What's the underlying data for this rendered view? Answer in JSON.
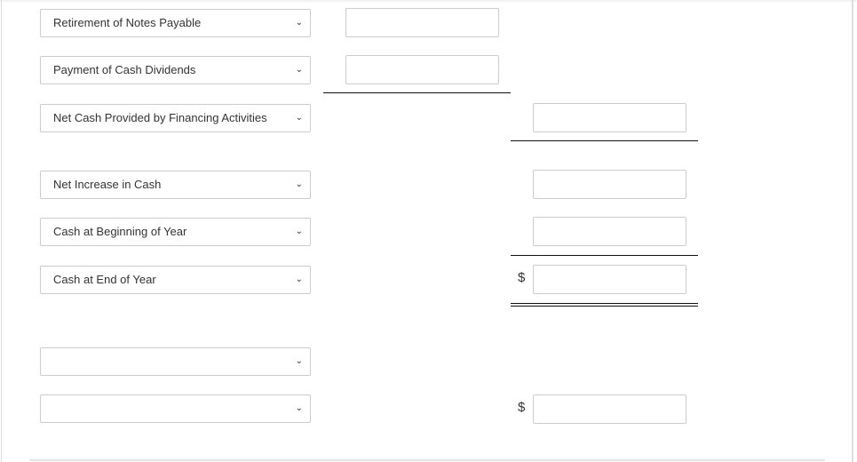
{
  "rows": [
    {
      "label": "Retirement of Notes Payable"
    },
    {
      "label": "Payment of Cash Dividends"
    },
    {
      "label": "Net Cash Provided by Financing Activities"
    },
    {
      "label": "Net Increase in Cash"
    },
    {
      "label": "Cash at Beginning of Year"
    },
    {
      "label": "Cash at End of Year"
    },
    {
      "label": ""
    },
    {
      "label": ""
    }
  ],
  "currency_symbol": "$",
  "chevron": "⌄"
}
